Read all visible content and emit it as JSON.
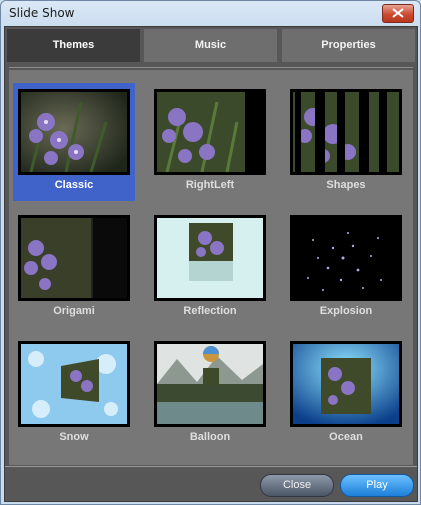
{
  "window": {
    "title": "Slide Show"
  },
  "tabs": [
    {
      "label": "Themes",
      "active": true
    },
    {
      "label": "Music",
      "active": false
    },
    {
      "label": "Properties",
      "active": false
    }
  ],
  "themes": [
    {
      "label": "Classic",
      "selected": true
    },
    {
      "label": "RightLeft",
      "selected": false
    },
    {
      "label": "Shapes",
      "selected": false
    },
    {
      "label": "Origami",
      "selected": false
    },
    {
      "label": "Reflection",
      "selected": false
    },
    {
      "label": "Explosion",
      "selected": false
    },
    {
      "label": "Snow",
      "selected": false
    },
    {
      "label": "Balloon",
      "selected": false
    },
    {
      "label": "Ocean",
      "selected": false
    }
  ],
  "buttons": {
    "close": "Close",
    "play": "Play"
  },
  "colors": {
    "selection": "#3f63c9",
    "play": "#1d7fd8"
  }
}
